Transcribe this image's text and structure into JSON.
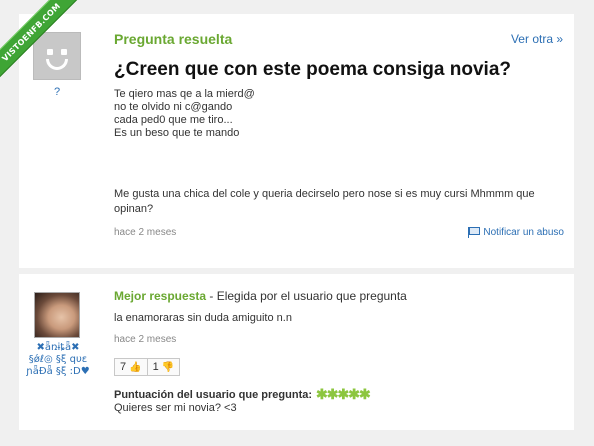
{
  "watermark": "VISTOENFB.COM",
  "question": {
    "status": "Pregunta resuelta",
    "see_other": "Ver otra »",
    "asker": "?",
    "title": "¿Creen que con este poema consiga novia?",
    "poem": [
      "Te qiero mas qe a la mierd@",
      "no te olvido ni c@gando",
      "cada ped0 que me tiro...",
      "Es un beso que te mando"
    ],
    "detail": "Me gusta una chica del cole y queria decirselo pero nose si es muy cursi Mhmmm que opinan?",
    "time": "hace 2 meses",
    "report": "Notificar un abuso"
  },
  "answer": {
    "answerer_lines": [
      "✖ǟռɨȶǟ✖",
      "§ǿℓ◎ §ξ qυε",
      "ɲǟÐǟ §ξ :D♥"
    ],
    "best_title": "Mejor respuesta",
    "best_sub": " - Elegida por el usuario que pregunta",
    "text": "la enamoraras sin duda amiguito n.n",
    "time": "hace 2 meses",
    "votes_up": "7",
    "votes_down": "1",
    "rating_label": "Puntuación del usuario que pregunta:",
    "rating_stars": 5,
    "rating_comment": "Quieres ser mi novia? <3"
  }
}
